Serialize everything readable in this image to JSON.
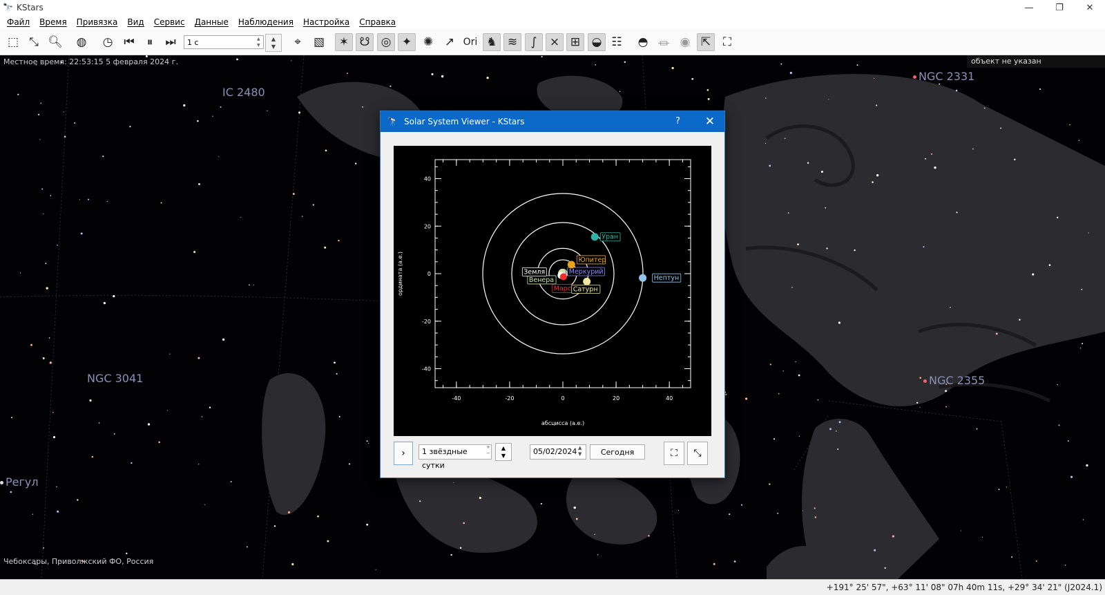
{
  "window": {
    "title": "KStars",
    "controls": [
      "—",
      "❐",
      "✕"
    ]
  },
  "menu": [
    "Файл",
    "Время",
    "Привязка",
    "Вид",
    "Сервис",
    "Данные",
    "Наблюдения",
    "Настройка",
    "Справка"
  ],
  "toolbar": {
    "time_step": "1 c",
    "icons": [
      "zoom-to-fit-icon",
      "zoom-out-box-icon",
      "search-icon",
      "globe-icon",
      "clock-icon",
      "step-back-icon",
      "pause-icon",
      "step-forward-icon",
      "crosshair-icon",
      "image-icon",
      "stars-icon",
      "constellation-lines-icon",
      "target-icon",
      "plus-star-icon",
      "satellite-icon",
      "line-icon",
      "ori-icon",
      "figure-icon",
      "milky-way-icon",
      "horizon-icon",
      "equator-icon",
      "grid-icon",
      "ellipse-icon",
      "list-icon",
      "flask-icon",
      "telescope-icon",
      "eye-icon",
      "pointer-icon",
      "fullscreen-icon"
    ]
  },
  "sky": {
    "local_time": "Местное время: 22:53:15   5 февраля 2024 г.",
    "no_object": "объект не указан",
    "location": "Чебоксары, Приволжский ФО, Россия",
    "labels": [
      {
        "name": "IC 2480",
        "dot": false
      },
      {
        "name": "NGC 2331",
        "dot": true
      },
      {
        "name": "NGC 3041",
        "dot": false
      },
      {
        "name": "NGC 2355",
        "dot": true
      },
      {
        "name": "Регул",
        "dot": false
      }
    ]
  },
  "status": {
    "coords": "+191° 25' 57\", +63° 11' 08\"  07h 40m 11s, +29° 34' 21\" (J2024.1)"
  },
  "dialog": {
    "title": "Solar System Viewer - KStars",
    "help": "?",
    "close": "✕",
    "step": "1 звёздные сутки",
    "date": "05/02/2024",
    "today": "Сегодня",
    "colors": {
      "titlebar": "#0a68c8"
    }
  },
  "chart_data": {
    "type": "scatter",
    "xlabel": "абсцисса (а.е.)",
    "ylabel": "ордината (а.е.)",
    "xlim": [
      -48,
      48
    ],
    "ylim": [
      -48,
      48
    ],
    "x_ticks": [
      -40,
      -20,
      0,
      20,
      40
    ],
    "y_ticks": [
      40,
      20,
      0,
      -20,
      -40
    ],
    "orbits": [
      1.5,
      5.2,
      9.5,
      19.2,
      30.1
    ],
    "planets": [
      {
        "name": "Меркурий",
        "x": 0.2,
        "y": 0.3,
        "color": "#8a8aff"
      },
      {
        "name": "Венера",
        "x": -0.3,
        "y": 0.6,
        "color": "#c8e6a0"
      },
      {
        "name": "Земля",
        "x": -0.7,
        "y": -0.7,
        "color": "#ffffff"
      },
      {
        "name": "Марс",
        "x": 0.2,
        "y": -1.3,
        "color": "#ff2a2a"
      },
      {
        "name": "Юпитер",
        "x": 3.2,
        "y": 3.8,
        "color": "#e8a41a"
      },
      {
        "name": "Сатурн",
        "x": 9.0,
        "y": -3.3,
        "color": "#f2e6a0"
      },
      {
        "name": "Уран",
        "x": 12.0,
        "y": 15.5,
        "color": "#2ab5a5"
      },
      {
        "name": "Нептун",
        "x": 30.0,
        "y": -1.8,
        "color": "#8ec8f0"
      }
    ]
  }
}
